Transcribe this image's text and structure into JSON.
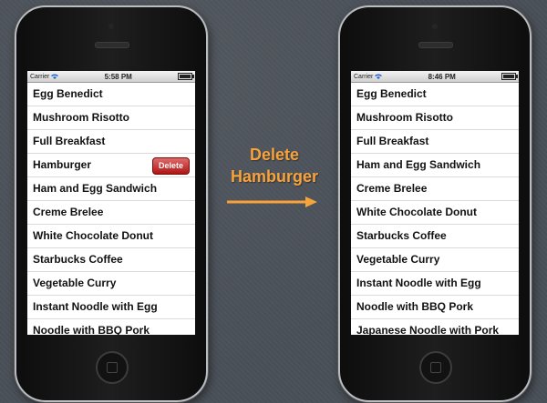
{
  "left_phone": {
    "status": {
      "carrier": "Carrier",
      "time": "5:58 PM"
    },
    "rows": [
      "Egg Benedict",
      "Mushroom Risotto",
      "Full Breakfast",
      "Hamburger",
      "Ham and Egg Sandwich",
      "Creme Brelee",
      "White Chocolate Donut",
      "Starbucks Coffee",
      "Vegetable Curry",
      "Instant Noodle with Egg",
      "Noodle with BBQ Pork"
    ],
    "delete_label": "Delete"
  },
  "right_phone": {
    "status": {
      "carrier": "Carrier",
      "time": "8:46 PM"
    },
    "rows": [
      "Egg Benedict",
      "Mushroom Risotto",
      "Full Breakfast",
      "Ham and Egg Sandwich",
      "Creme Brelee",
      "White Chocolate Donut",
      "Starbucks Coffee",
      "Vegetable Curry",
      "Instant Noodle with Egg",
      "Noodle with BBQ Pork",
      "Japanese Noodle with Pork"
    ]
  },
  "center": {
    "line1": "Delete",
    "line2": "Hamburger"
  },
  "colors": {
    "accent": "#f7a23a",
    "delete": "#c41e1e"
  }
}
